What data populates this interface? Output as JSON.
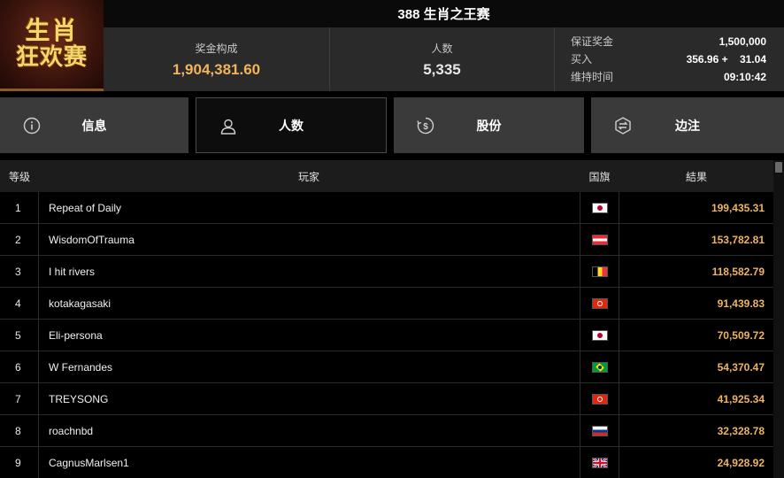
{
  "logo": {
    "line1": "生肖",
    "line2": "狂欢赛"
  },
  "title": "388 生肖之王赛",
  "stats": {
    "prize_label": "奖金构成",
    "prize_value": "1,904,381.60",
    "entries_label": "人数",
    "entries_value": "5,335",
    "guaranteed_label": "保证奖金",
    "guaranteed_value": "1,500,000",
    "buyin_label": "买入",
    "buyin_value": "356.96 +    31.04",
    "time_label": "维持时间",
    "time_value": "09:10:42"
  },
  "tabs": [
    {
      "label": "信息",
      "icon": "info-icon"
    },
    {
      "label": "人数",
      "icon": "user-icon"
    },
    {
      "label": "股份",
      "icon": "dollar-coin-icon"
    },
    {
      "label": "边注",
      "icon": "sidebet-icon"
    }
  ],
  "active_tab": "人数",
  "table": {
    "headers": {
      "rank": "等级",
      "player": "玩家",
      "flag": "国旗",
      "result": "結果"
    },
    "rows": [
      {
        "rank": "1",
        "player": "Repeat of Daily",
        "flag": "japan",
        "result": "199,435.31"
      },
      {
        "rank": "2",
        "player": "WisdomOfTrauma",
        "flag": "austria",
        "result": "153,782.81"
      },
      {
        "rank": "3",
        "player": "I hit rivers",
        "flag": "belgium",
        "result": "118,582.79"
      },
      {
        "rank": "4",
        "player": "kotakagasaki",
        "flag": "hong-kong",
        "result": "91,439.83"
      },
      {
        "rank": "5",
        "player": "Eli-persona",
        "flag": "japan",
        "result": "70,509.72"
      },
      {
        "rank": "6",
        "player": "W Fernandes",
        "flag": "brazil",
        "result": "54,370.47"
      },
      {
        "rank": "7",
        "player": "TREYSONG",
        "flag": "hong-kong",
        "result": "41,925.34"
      },
      {
        "rank": "8",
        "player": "roachnbd",
        "flag": "russia",
        "result": "32,328.78"
      },
      {
        "rank": "9",
        "player": "CagnusMarlsen1",
        "flag": "united-kingdom",
        "result": "24,928.92"
      }
    ]
  },
  "colors": {
    "accent_gold": "#f0b45a",
    "panel": "#2a2a2a",
    "tab": "#3a3a3a"
  }
}
